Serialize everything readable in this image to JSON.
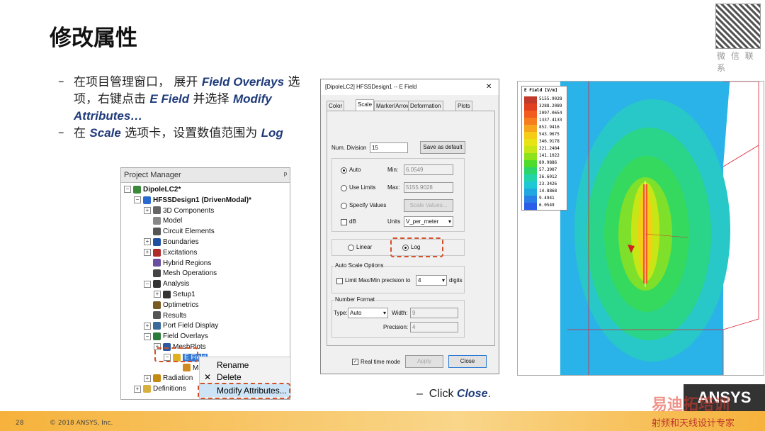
{
  "slide": {
    "title": "修改属性",
    "qr_label": "微 信 联 系",
    "bullets": [
      {
        "dash": "–",
        "parts": [
          "在项目管理窗口， 展开 ",
          "Field Overlays",
          " 选项，右键点击 ",
          "E Field",
          " 并选择 ",
          "Modify Attributes…"
        ]
      },
      {
        "dash": "–",
        "parts": [
          "在 ",
          "Scale",
          " 选项卡，设置数值范围为 ",
          "Log"
        ]
      }
    ],
    "close_note": {
      "dash": "–",
      "prefix": "Click ",
      "bold": "Close",
      "suffix": "."
    },
    "page_number": "28",
    "copyright": "© 2018 ANSYS, Inc.",
    "logo": "ANSYS",
    "watermark": "易迪拓培训",
    "watermark_sub": "射频和天线设计专家"
  },
  "project_manager": {
    "header": "Project Manager",
    "pin": "ᵖ",
    "items": [
      {
        "label": "DipoleLC2*",
        "exp": "⊟",
        "icon": "project-icon",
        "bold": true
      },
      {
        "label": "HFSSDesign1 (DrivenModal)*",
        "exp": "⊟",
        "icon": "design-icon",
        "bold": true
      },
      {
        "label": "3D Components",
        "exp": "⊞",
        "icon": "components-icon"
      },
      {
        "label": "Model",
        "exp": "",
        "icon": "model-icon"
      },
      {
        "label": "Circuit Elements",
        "exp": "",
        "icon": "circuit-icon"
      },
      {
        "label": "Boundaries",
        "exp": "⊞",
        "icon": "boundaries-icon"
      },
      {
        "label": "Excitations",
        "exp": "⊞",
        "icon": "excitations-icon"
      },
      {
        "label": "Hybrid Regions",
        "exp": "",
        "icon": "hybrid-icon"
      },
      {
        "label": "Mesh Operations",
        "exp": "",
        "icon": "mesh-icon"
      },
      {
        "label": "Analysis",
        "exp": "⊟",
        "icon": "analysis-icon"
      },
      {
        "label": "Setup1",
        "exp": "⊞",
        "icon": "setup-icon"
      },
      {
        "label": "Optimetrics",
        "exp": "",
        "icon": "optimetrics-icon"
      },
      {
        "label": "Results",
        "exp": "",
        "icon": "results-icon"
      },
      {
        "label": "Port Field Display",
        "exp": "⊞",
        "icon": "port-icon"
      },
      {
        "label": "Field Overlays",
        "exp": "⊟",
        "icon": "overlays-icon"
      },
      {
        "label": "MeshPlots",
        "exp": "⊞",
        "icon": "meshplots-icon"
      },
      {
        "label": "E Field",
        "exp": "⊟",
        "icon": "efield-icon",
        "selected": true
      },
      {
        "label": "Mag_",
        "exp": "",
        "icon": "mag-icon"
      },
      {
        "label": "Radiation",
        "exp": "⊞",
        "icon": "radiation-icon"
      },
      {
        "label": "Definitions",
        "exp": "⊞",
        "icon": "definitions-icon"
      }
    ]
  },
  "context_menu": {
    "items": [
      {
        "label": "Rename",
        "icon": ""
      },
      {
        "label": "Delete",
        "icon": "✕"
      },
      {
        "label": "Modify Attributes...",
        "icon": ""
      }
    ]
  },
  "dialog": {
    "title": "[DipoleLC2] HFSSDesign1 -- E Field",
    "close": "✕",
    "tabs": [
      "Color map",
      "Scale",
      "Marker/Arrow",
      "Deformation Scale",
      "Plots"
    ],
    "active_tab": "Scale",
    "num_division_label": "Num. Division",
    "num_division": "15",
    "save_default": "Save as default",
    "auto_label": "Auto",
    "use_limits_label": "Use Limits",
    "specify_values_label": "Specify Values",
    "min_label": "Min:",
    "min_value": "6.0549",
    "max_label": "Max:",
    "max_value": "5155.9028",
    "scale_values_btn": "Scale Values...",
    "db_label": "dB",
    "units_label": "Units",
    "units_value": "V_per_meter",
    "linear_label": "Linear",
    "log_label": "Log",
    "auto_scale_group": "Auto Scale Options",
    "limit_label": "Limit Max/Min precision to",
    "limit_value": "4",
    "digits_label": "digits",
    "number_format_group": "Number Format",
    "type_label": "Type:",
    "type_value": "Auto",
    "width_label": "Width:",
    "width_value": "9",
    "precision_label": "Precision:",
    "precision_value": "4",
    "realtime_label": "Real time mode",
    "apply": "Apply",
    "close_btn": "Close"
  },
  "plot": {
    "legend_title": "E Field [V/m]",
    "legend_values": [
      "5155.9028",
      "3288.2089",
      "2097.0654",
      "1337.4133",
      "852.9416",
      "543.9675",
      "346.9178",
      "221.2484",
      "141.1022",
      "89.9886",
      "57.3907",
      "36.6012",
      "23.3426",
      "14.8868",
      "9.4941",
      "6.0549"
    ],
    "legend_colors": [
      "#c0392b",
      "#e04020",
      "#f25c1e",
      "#f57d1e",
      "#f7a51c",
      "#f5cd16",
      "#e8e314",
      "#c8e616",
      "#8ee21c",
      "#4fdc2a",
      "#2cd66a",
      "#22d4a8",
      "#1ec8d4",
      "#22a8e0",
      "#2a7fe6",
      "#2a5ee8"
    ]
  }
}
